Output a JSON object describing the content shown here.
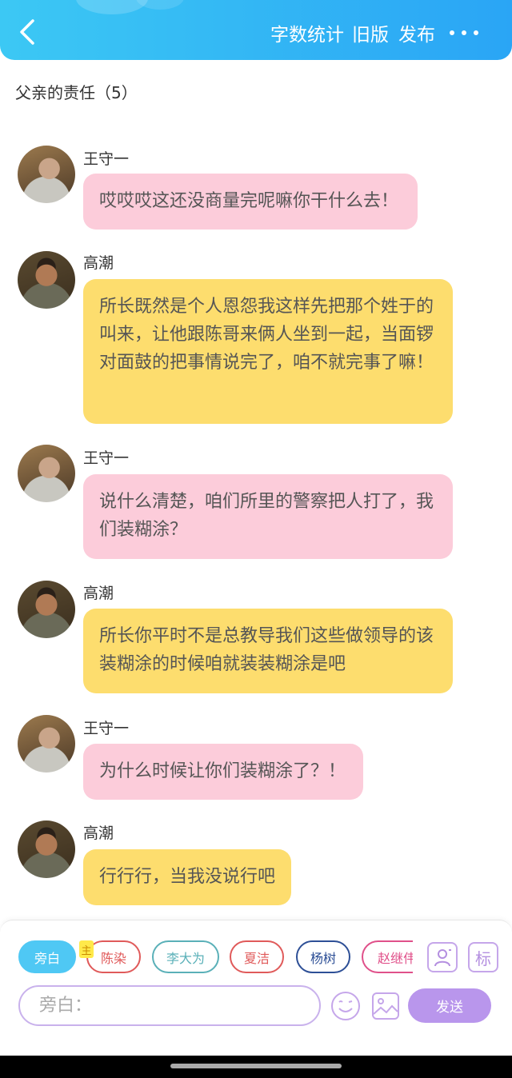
{
  "header": {
    "word_count_label": "字数统计",
    "old_version_label": "旧版",
    "publish_label": "发布"
  },
  "chapter": {
    "title": "父亲的责任（5）"
  },
  "messages": [
    {
      "speaker": "王守一",
      "text": "哎哎哎这还没商量完呢嘛你干什么去！"
    },
    {
      "speaker": "高潮",
      "text": "所长既然是个人恩怨我这样先把那个姓于的叫来，让他跟陈哥来俩人坐到一起，当面锣对面鼓的把事情说完了，咱不就完事了嘛！"
    },
    {
      "speaker": "王守一",
      "text": "说什么清楚，咱们所里的警察把人打了，我们装糊涂？"
    },
    {
      "speaker": "高潮",
      "text": "所长你平时不是总教导我们这些做领导的该装糊涂的时候咱就装装糊涂是吧"
    },
    {
      "speaker": "王守一",
      "text": "为什么时候让你们装糊涂了？！"
    },
    {
      "speaker": "高潮",
      "text": "行行行，当我没说行吧"
    }
  ],
  "roles": [
    {
      "label": "旁白",
      "color": "#4fc8f4"
    },
    {
      "label": "陈染",
      "color": "#e05a5a"
    },
    {
      "label": "李大为",
      "color": "#5ab0b8"
    },
    {
      "label": "夏洁",
      "color": "#e05a5a"
    },
    {
      "label": "杨树",
      "color": "#2d4f96"
    },
    {
      "label": "赵继伟",
      "color": "#e0508a"
    }
  ],
  "main_tag": "主",
  "tools": {
    "avatar_icon": "person-card-icon",
    "tag_label": "标"
  },
  "input": {
    "placeholder": "旁白："
  },
  "send_label": "发送",
  "colors": {
    "header": "#2aa5f5",
    "pink_bubble": "#fcccda",
    "yellow_bubble": "#fddd6e",
    "accent_purple": "#b996ec"
  }
}
